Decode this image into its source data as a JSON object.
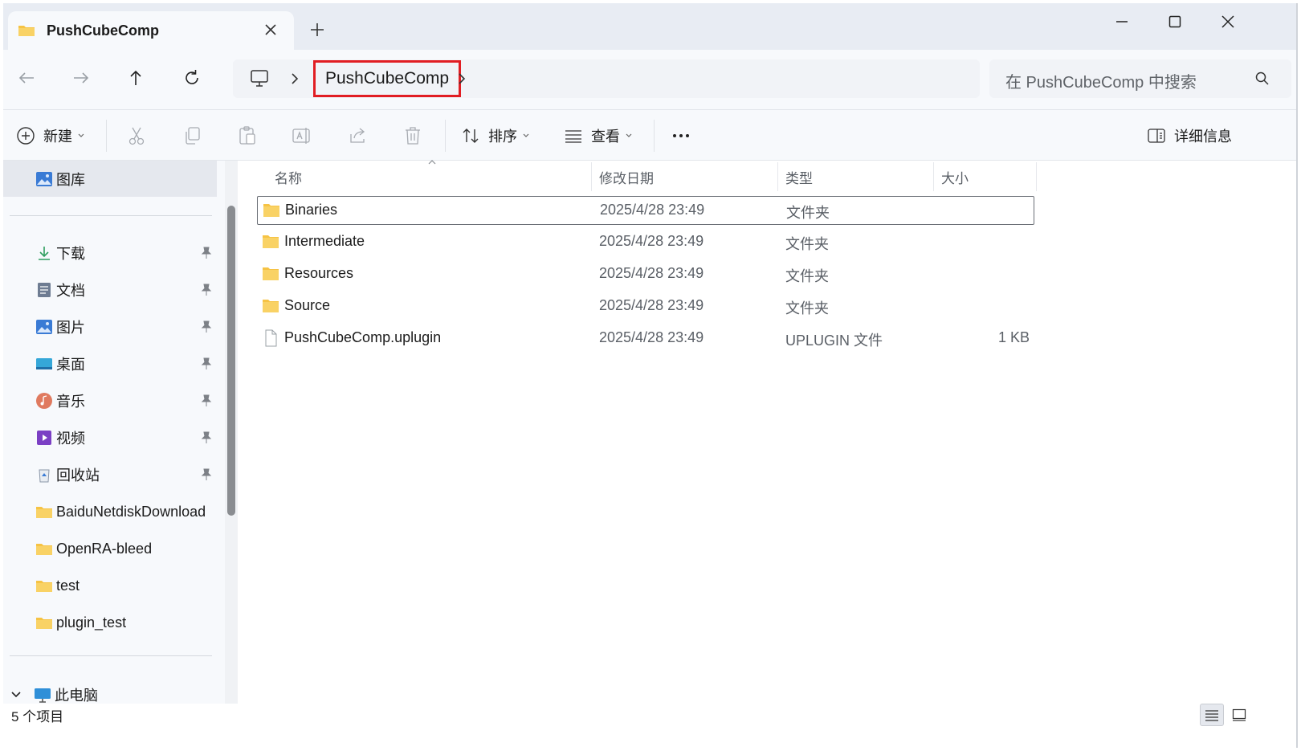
{
  "tab": {
    "title": "PushCubeComp"
  },
  "address": {
    "breadcrumb": "PushCubeComp"
  },
  "search": {
    "placeholder": "在 PushCubeComp 中搜索"
  },
  "toolbar": {
    "new_label": "新建",
    "sort_label": "排序",
    "view_label": "查看",
    "details_label": "详细信息"
  },
  "sidebar": {
    "gallery": "图库",
    "quick_access": [
      {
        "label": "下载",
        "icon": "download-icon"
      },
      {
        "label": "文档",
        "icon": "documents-icon"
      },
      {
        "label": "图片",
        "icon": "pictures-icon"
      },
      {
        "label": "桌面",
        "icon": "desktop-icon"
      },
      {
        "label": "音乐",
        "icon": "music-icon"
      },
      {
        "label": "视频",
        "icon": "videos-icon"
      },
      {
        "label": "回收站",
        "icon": "recycle-bin-icon"
      },
      {
        "label": "BaiduNetdiskDownload",
        "icon": "folder-icon"
      },
      {
        "label": "OpenRA-bleed",
        "icon": "folder-icon"
      },
      {
        "label": "test",
        "icon": "folder-icon"
      },
      {
        "label": "plugin_test",
        "icon": "folder-icon"
      }
    ],
    "this_pc": "此电脑"
  },
  "columns": {
    "name": "名称",
    "modified": "修改日期",
    "type": "类型",
    "size": "大小"
  },
  "files": [
    {
      "name": "Binaries",
      "modified": "2025/4/28 23:49",
      "type": "文件夹",
      "size": "",
      "icon": "folder-icon"
    },
    {
      "name": "Intermediate",
      "modified": "2025/4/28 23:49",
      "type": "文件夹",
      "size": "",
      "icon": "folder-icon"
    },
    {
      "name": "Resources",
      "modified": "2025/4/28 23:49",
      "type": "文件夹",
      "size": "",
      "icon": "folder-icon"
    },
    {
      "name": "Source",
      "modified": "2025/4/28 23:49",
      "type": "文件夹",
      "size": "",
      "icon": "folder-icon"
    },
    {
      "name": "PushCubeComp.uplugin",
      "modified": "2025/4/28 23:49",
      "type": "UPLUGIN 文件",
      "size": "1 KB",
      "icon": "file-icon"
    }
  ],
  "status": {
    "item_count": "5 个项目"
  },
  "colors": {
    "highlight_border": "#e11d23",
    "folder_yellow": "#f6c344",
    "titlebar_bg": "#e8ecf3"
  }
}
